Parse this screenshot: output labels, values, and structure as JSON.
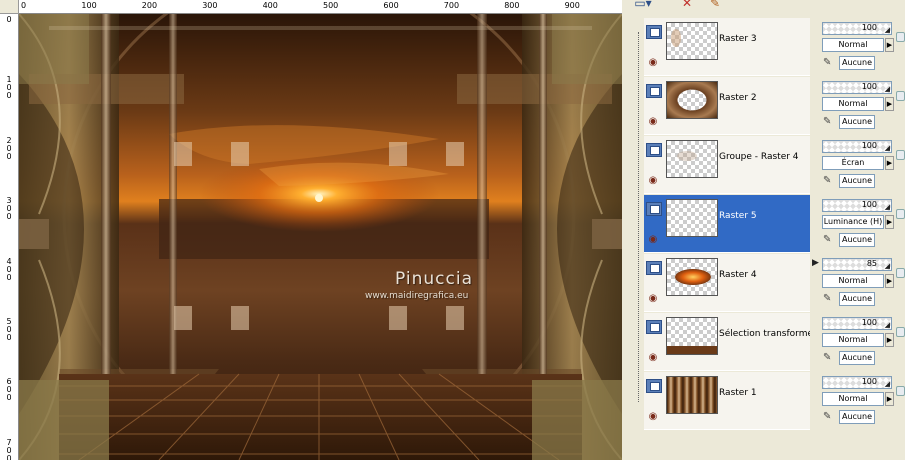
{
  "ruler": {
    "horizontal_labels": [
      "0",
      "100",
      "200",
      "300",
      "400",
      "500",
      "600",
      "700",
      "800",
      "900"
    ],
    "vertical_labels": [
      "0",
      "100",
      "200",
      "300",
      "400",
      "500",
      "600",
      "700"
    ]
  },
  "canvas": {
    "watermark_name": "Pinuccia",
    "watermark_url": "www.maidiregrafica.eu"
  },
  "toolbar": {
    "icons": [
      "layer-menu-icon",
      "delete-layer-icon",
      "paint-icon"
    ]
  },
  "layers": [
    {
      "name": "Raster 3",
      "opacity": "100",
      "blend": "Normal",
      "lock": "Aucune",
      "selected": false,
      "thumb": "wisp"
    },
    {
      "name": "Raster 2",
      "opacity": "100",
      "blend": "Normal",
      "lock": "Aucune",
      "selected": false,
      "thumb": "frame"
    },
    {
      "name": "Groupe - Raster 4",
      "opacity": "100",
      "blend": "Écran",
      "lock": "Aucune",
      "selected": false,
      "thumb": "faint"
    },
    {
      "name": "Raster 5",
      "opacity": "100",
      "blend": "Luminance (H)",
      "lock": "Aucune",
      "selected": true,
      "thumb": "empty"
    },
    {
      "name": "Raster 4",
      "opacity": "85",
      "blend": "Normal",
      "lock": "Aucune",
      "selected": false,
      "thumb": "sunset"
    },
    {
      "name": "Sélection transformée",
      "opacity": "100",
      "blend": "Normal",
      "lock": "Aucune",
      "selected": false,
      "thumb": "strip"
    },
    {
      "name": "Raster 1",
      "opacity": "100",
      "blend": "Normal",
      "lock": "Aucune",
      "selected": false,
      "thumb": "brown"
    }
  ],
  "colors": {
    "selection": "#316ac5",
    "panel_bg": "#ece9d8",
    "image_dark": "#3a2212",
    "image_sun": "#ff7a10"
  }
}
